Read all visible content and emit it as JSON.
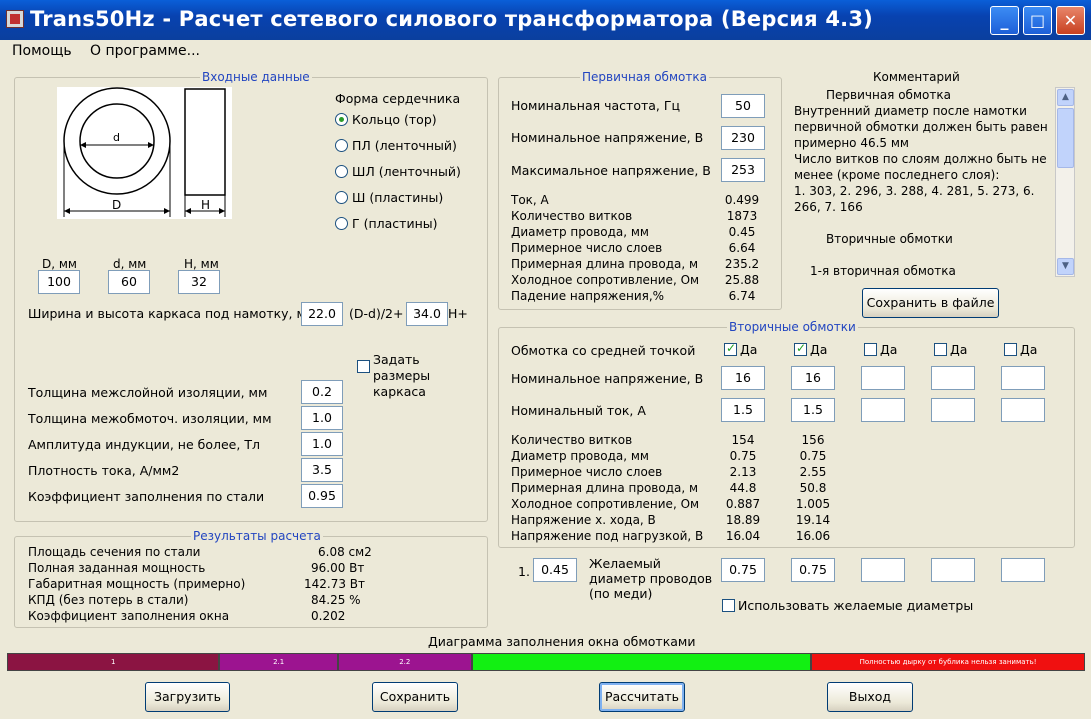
{
  "window": {
    "title": "Trans50Hz - Расчет сетевого силового трансформатора (Версия 4.3)",
    "minimize": "_",
    "maximize": "□",
    "close": "✕"
  },
  "menu": [
    "Помощь",
    "О программе..."
  ],
  "input": {
    "group_title": "Входные данные",
    "core_label": "Форма сердечника",
    "core_options": [
      "Кольцо (тор)",
      "ПЛ (ленточный)",
      "ШЛ (ленточный)",
      "Ш (пластины)",
      "Г (пластины)"
    ],
    "core_selected": 0,
    "diagram": {
      "d": "d",
      "D": "D",
      "H": "H"
    },
    "dims": [
      {
        "label": "D, мм",
        "value": "100"
      },
      {
        "label": "d, мм",
        "value": "60"
      },
      {
        "label": "H, мм",
        "value": "32"
      }
    ],
    "frame_label": "Ширина и высота каркаса под намотку, мм",
    "frame_w": "22.0",
    "frame_w_suffix": "(D-d)/2+",
    "frame_h": "34.0",
    "frame_h_suffix": "H+",
    "frame_checkbox": "Задать размеры каркаса",
    "params": [
      {
        "label": "Толщина межслойной изоляции, мм",
        "value": "0.2"
      },
      {
        "label": "Толщина межобмоточ. изоляции, мм",
        "value": "1.0"
      },
      {
        "label": "Амплитуда индукции, не более, Тл",
        "value": "1.0"
      },
      {
        "label": "Плотность тока, А/мм2",
        "value": "3.5"
      },
      {
        "label": "Коэффициент заполнения по стали",
        "value": "0.95"
      }
    ]
  },
  "results": {
    "group_title": "Результаты расчета",
    "rows": [
      {
        "label": "Площадь сечения по стали",
        "value": "6.08 см2"
      },
      {
        "label": "Полная заданная мощность",
        "value": "96.00 Вт"
      },
      {
        "label": "Габаритная мощность (примерно)",
        "value": "142.73 Вт"
      },
      {
        "label": "КПД (без потерь в стали)",
        "value": "84.25 %"
      },
      {
        "label": "Коэффициент заполнения окна",
        "value": "0.202"
      }
    ]
  },
  "primary": {
    "group_title": "Первичная обмотка",
    "inputs": [
      {
        "label": "Номинальная частота, Гц",
        "value": "50"
      },
      {
        "label": "Номинальное напряжение, В",
        "value": "230"
      },
      {
        "label": "Максимальное напряжение, В",
        "value": "253"
      }
    ],
    "rows": [
      {
        "label": "Ток, А",
        "value": "0.499"
      },
      {
        "label": "Количество витков",
        "value": "1873"
      },
      {
        "label": "Диаметр провода, мм",
        "value": "0.45"
      },
      {
        "label": "Примерное число слоев",
        "value": "6.64"
      },
      {
        "label": "Примерная длина провода, м",
        "value": "235.2"
      },
      {
        "label": "Холодное сопротивление, Ом",
        "value": "25.88"
      },
      {
        "label": "Падение напряжения,%",
        "value": "6.74"
      }
    ]
  },
  "comment": {
    "title": "Комментарий",
    "lines": [
      "Первичная обмотка",
      "Внутренний диаметр после намотки",
      "первичной обмотки должен быть равен",
      "примерно 46.5 мм",
      "Число витков по слоям должно быть не",
      "менее (кроме последнего слоя):",
      "1. 303,  2. 296,  3. 288,  4. 281,  5. 273,  6.",
      "266,  7. 166",
      "",
      "Вторичные обмотки",
      "",
      "1-я вторичная обмотка"
    ],
    "save_button": "Сохранить в файле"
  },
  "secondary": {
    "group_title": "Вторичные обмотки",
    "center_tap_label": "Обмотка со средней точкой",
    "yes_label": "Да",
    "center_tap_checked": [
      true,
      true,
      false,
      false,
      false
    ],
    "voltage_label": "Номинальное напряжение, В",
    "voltage": [
      "16",
      "16",
      "",
      "",
      ""
    ],
    "current_label": "Номинальный ток, А",
    "current": [
      "1.5",
      "1.5",
      "",
      "",
      ""
    ],
    "rows": [
      {
        "label": "Количество витков",
        "values": [
          "154",
          "156"
        ]
      },
      {
        "label": "Диаметр провода, мм",
        "values": [
          "0.75",
          "0.75"
        ]
      },
      {
        "label": "Примерное число слоев",
        "values": [
          "2.13",
          "2.55"
        ]
      },
      {
        "label": "Примерная длина провода, м",
        "values": [
          "44.8",
          "50.8"
        ]
      },
      {
        "label": "Холодное сопротивление, Ом",
        "values": [
          "0.887",
          "1.005"
        ]
      },
      {
        "label": "Напряжение х. хода, В",
        "values": [
          "18.89",
          "19.14"
        ]
      },
      {
        "label": "Напряжение под нагрузкой, В",
        "values": [
          "16.04",
          "16.06"
        ]
      }
    ],
    "desired_prefix": "1.",
    "desired_primary": "0.45",
    "desired_label": "Желаемый диаметр проводов (по меди)",
    "desired": [
      "0.75",
      "0.75",
      "",
      "",
      ""
    ],
    "use_desired_label": "Использовать желаемые диаметры"
  },
  "diagram_bar": {
    "title": "Диаграмма заполнения окна обмотками",
    "segments": [
      {
        "label": "1",
        "fraction": 0.197,
        "color": "#8b1442"
      },
      {
        "label": "2.1",
        "fraction": 0.11,
        "color": "#9c1490"
      },
      {
        "label": "2.2",
        "fraction": 0.124,
        "color": "#9c1490"
      },
      {
        "label": "",
        "fraction": 0.315,
        "color": "#12f012"
      },
      {
        "label": "Полностью дырку от бублика нельзя занимать!",
        "fraction": 0.254,
        "color": "#f01010"
      }
    ]
  },
  "buttons": {
    "load": "Загрузить",
    "save": "Сохранить",
    "calc": "Рассчитать",
    "exit": "Выход"
  }
}
